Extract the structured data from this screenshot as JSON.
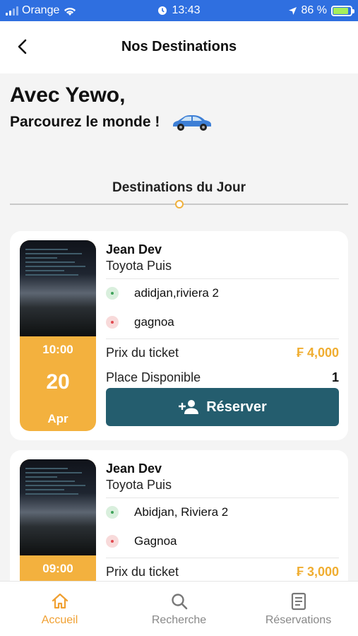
{
  "status_bar": {
    "carrier": "Orange",
    "time": "13:43",
    "battery": "86 %"
  },
  "header": {
    "title": "Nos Destinations"
  },
  "intro": {
    "title": "Avec Yewo,",
    "subtitle": "Parcourez le monde !"
  },
  "section": {
    "title": "Destinations du Jour"
  },
  "cards": [
    {
      "driver": "Jean Dev",
      "car": "Toyota Puis",
      "from": "adidjan,riviera 2",
      "to": "gagnoa",
      "price_label": "Prix du ticket",
      "price": "₣ 4,000",
      "seats_label": "Place Disponible",
      "seats": "1",
      "time": "10:00",
      "day": "20",
      "month": "Apr",
      "button": "Réserver"
    },
    {
      "driver": "Jean Dev",
      "car": "Toyota Puis",
      "from": "Abidjan, Riviera 2",
      "to": "Gagnoa",
      "price_label": "Prix du ticket",
      "price": "₣ 3,000",
      "time": "09:00"
    }
  ],
  "bottom_nav": [
    {
      "label": "Accueil",
      "icon": "home-icon",
      "active": true
    },
    {
      "label": "Recherche",
      "icon": "search-icon",
      "active": false
    },
    {
      "label": "Réservations",
      "icon": "list-icon",
      "active": false
    }
  ],
  "colors": {
    "accent": "#f0ad30",
    "button": "#245d6e",
    "status_bar": "#2f6fe0"
  }
}
